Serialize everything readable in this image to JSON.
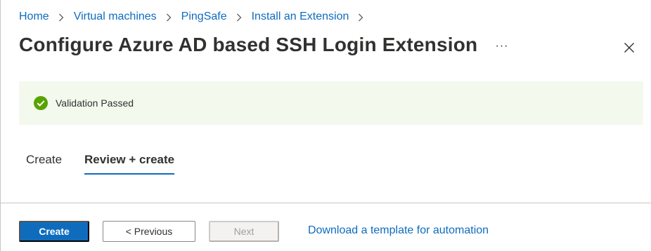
{
  "breadcrumb": {
    "items": [
      {
        "label": "Home"
      },
      {
        "label": "Virtual machines"
      },
      {
        "label": "PingSafe"
      },
      {
        "label": "Install an Extension"
      }
    ]
  },
  "header": {
    "title": "Configure Azure AD based SSH Login Extension",
    "more_icon": "ellipsis-icon",
    "more_label": "···",
    "close_icon": "close-icon"
  },
  "validation": {
    "icon": "check-circle-icon",
    "text": "Validation Passed",
    "icon_color": "#57a300",
    "background": "#f3f9ed"
  },
  "tabs": [
    {
      "label": "Create",
      "selected": false
    },
    {
      "label": "Review + create",
      "selected": true
    }
  ],
  "footer": {
    "create_label": "Create",
    "previous_label": "< Previous",
    "next_label": "Next",
    "next_disabled": true,
    "download_link": "Download a template for automation"
  },
  "colors": {
    "accent": "#0f6cbd",
    "success": "#57a300"
  }
}
